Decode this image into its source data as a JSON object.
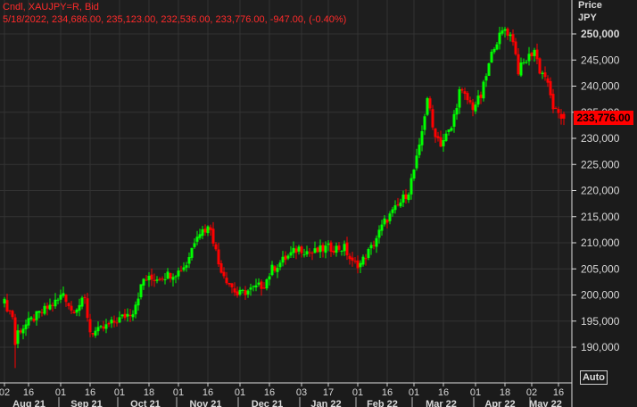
{
  "header": {
    "line1": "Cndl, XAUJPY=R, Bid",
    "line2": "5/18/2022, 234,686.00, 235,123.00, 232,536.00, 233,776.00, -947.00, (-0.40%)"
  },
  "axis": {
    "title": "Price",
    "unit": "JPY",
    "auto_label": "Auto",
    "last_price_label": "233,776.00"
  },
  "colors": {
    "up": "#00ff00",
    "down": "#ff0000",
    "text": "#ff2a2a",
    "bg": "#1b1b1b",
    "grid": "#333333"
  },
  "chart_data": {
    "type": "candlestick",
    "symbol": "XAUJPY=R",
    "ylim": [
      183000,
      255000
    ],
    "yticks": [
      190000,
      195000,
      200000,
      205000,
      210000,
      215000,
      220000,
      225000,
      230000,
      235000,
      240000,
      245000,
      250000
    ],
    "ytick_labels": [
      "190,000",
      "195,000",
      "200,000",
      "205,000",
      "210,000",
      "215,000",
      "220,000",
      "225,000",
      "230,000",
      "235,000",
      "240,000",
      "245,000",
      "250,000"
    ],
    "trading_days": 210,
    "close_anchors": [
      [
        0,
        198500
      ],
      [
        3,
        196000
      ],
      [
        4,
        190500
      ],
      [
        5,
        193000
      ],
      [
        12,
        196000
      ],
      [
        20,
        199000
      ],
      [
        22,
        200500
      ],
      [
        25,
        197000
      ],
      [
        30,
        199000
      ],
      [
        32,
        193000
      ],
      [
        35,
        193000
      ],
      [
        45,
        196000
      ],
      [
        48,
        197000
      ],
      [
        52,
        203000
      ],
      [
        55,
        203000
      ],
      [
        65,
        204500
      ],
      [
        68,
        206000
      ],
      [
        72,
        212000
      ],
      [
        77,
        213000
      ],
      [
        80,
        206000
      ],
      [
        83,
        203000
      ],
      [
        87,
        200000
      ],
      [
        92,
        201000
      ],
      [
        97,
        202000
      ],
      [
        100,
        205000
      ],
      [
        105,
        207000
      ],
      [
        110,
        209000
      ],
      [
        115,
        208000
      ],
      [
        120,
        209000
      ],
      [
        127,
        209000
      ],
      [
        130,
        206000
      ],
      [
        133,
        206000
      ],
      [
        137,
        209000
      ],
      [
        142,
        214000
      ],
      [
        147,
        217000
      ],
      [
        151,
        220000
      ],
      [
        155,
        228000
      ],
      [
        158,
        238000
      ],
      [
        160,
        232000
      ],
      [
        163,
        229000
      ],
      [
        167,
        232000
      ],
      [
        170,
        239000
      ],
      [
        172,
        238000
      ],
      [
        175,
        236000
      ],
      [
        178,
        238000
      ],
      [
        181,
        244000
      ],
      [
        183,
        248000
      ],
      [
        187,
        251000
      ],
      [
        190,
        249000
      ],
      [
        192,
        243000
      ],
      [
        195,
        245000
      ],
      [
        198,
        247000
      ],
      [
        200,
        243000
      ],
      [
        202,
        242000
      ],
      [
        205,
        236000
      ],
      [
        207,
        234000
      ],
      [
        209,
        233776
      ]
    ],
    "last_candle": {
      "date": "5/18/2022",
      "open": 234686,
      "high": 235123,
      "low": 232536,
      "close": 233776,
      "change": -947,
      "change_pct": -0.4
    },
    "xticks": [
      [
        0,
        "02"
      ],
      [
        9,
        "16"
      ],
      [
        21,
        "01"
      ],
      [
        32,
        "16"
      ],
      [
        43,
        "01"
      ],
      [
        54,
        "18"
      ],
      [
        65,
        "01"
      ],
      [
        76,
        "16"
      ],
      [
        88,
        "01"
      ],
      [
        99,
        "16"
      ],
      [
        111,
        "03"
      ],
      [
        121,
        "17"
      ],
      [
        132,
        "01"
      ],
      [
        143,
        "16"
      ],
      [
        153,
        "01"
      ],
      [
        164,
        "16"
      ],
      [
        176,
        "01"
      ],
      [
        187,
        "18"
      ],
      [
        197,
        "02"
      ],
      [
        207,
        "16"
      ]
    ],
    "months": [
      [
        0,
        "Aug 21"
      ],
      [
        21,
        "Sep 21"
      ],
      [
        43,
        "Oct 21"
      ],
      [
        65,
        "Nov 21"
      ],
      [
        88,
        "Dec 21"
      ],
      [
        111,
        "Jan 22"
      ],
      [
        132,
        "Feb 22"
      ],
      [
        153,
        "Mar 22"
      ],
      [
        176,
        "Apr 22"
      ],
      [
        197,
        "May 22"
      ]
    ]
  }
}
